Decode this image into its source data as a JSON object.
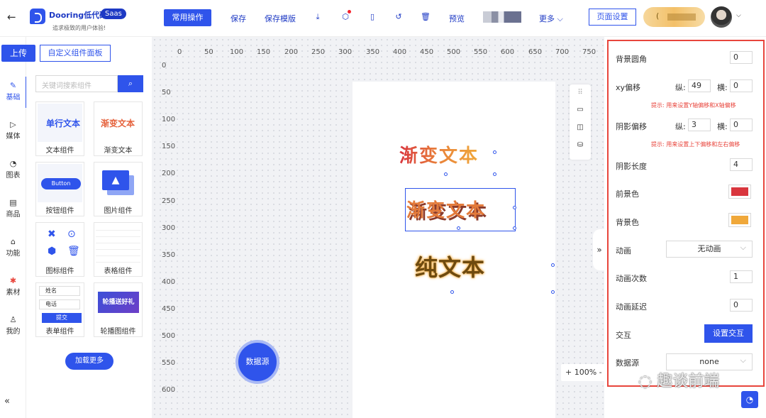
{
  "header": {
    "back_icon": "arrow-left-icon",
    "brand": "Dooring低代码",
    "badge": "Saas",
    "slogan": "追求极致的用户体验!",
    "primary_action": "常用操作",
    "save": "保存",
    "save_template": "保存模版",
    "preview": "预览",
    "more": "更多",
    "page_settings": "页面设置"
  },
  "toolbar": {
    "upload": "上传",
    "custom_panel": "自定义组件面板"
  },
  "nav": [
    {
      "label": "基础",
      "icon": "✎"
    },
    {
      "label": "媒体",
      "icon": "▷"
    },
    {
      "label": "图表",
      "icon": "◔"
    },
    {
      "label": "商品",
      "icon": "▤"
    },
    {
      "label": "功能",
      "icon": "⌂"
    },
    {
      "label": "素材",
      "icon": "✱"
    },
    {
      "label": "我的",
      "icon": "♙"
    }
  ],
  "components": {
    "search_placeholder": "关键词搜索组件",
    "items": [
      {
        "label": "文本组件",
        "thumb_text": "单行文本"
      },
      {
        "label": "渐变文本",
        "thumb_text": "渐变文本"
      },
      {
        "label": "按钮组件",
        "thumb_text": "Button"
      },
      {
        "label": "图片组件",
        "thumb_text": ""
      },
      {
        "label": "图标组件",
        "thumb_text": ""
      },
      {
        "label": "表格组件",
        "thumb_text": ""
      },
      {
        "label": "表单组件",
        "thumb_text": ""
      },
      {
        "label": "轮播图组件",
        "thumb_text": "轮播送好礼"
      }
    ],
    "form_thumb": {
      "name": "姓名",
      "phone": "电话",
      "submit": "提交"
    },
    "load_more": "加载更多"
  },
  "canvas": {
    "ruler_x": [
      "0",
      "50",
      "100",
      "150",
      "200",
      "250",
      "300",
      "350",
      "400",
      "450",
      "500",
      "550",
      "600",
      "650",
      "700",
      "750"
    ],
    "ruler_y": [
      "0",
      "50",
      "100",
      "150",
      "200",
      "250",
      "300",
      "350",
      "400",
      "450",
      "500",
      "550",
      "600"
    ],
    "text1": "渐变文本",
    "text2": "渐变文本",
    "text3": "纯文本",
    "data_source_btn": "数据源",
    "zoom": "+ 100% -"
  },
  "properties": {
    "bg_radius_label": "背景圆角",
    "bg_radius": "0",
    "xy_offset_label": "xy偏移",
    "vertical": "纵:",
    "horizontal": "横:",
    "xy_v": "49",
    "xy_h": "0",
    "xy_hint": "提示: 用来设置Y轴偏移和X轴偏移",
    "shadow_offset_label": "阴影偏移",
    "shadow_v": "3",
    "shadow_h": "0",
    "shadow_hint": "提示: 用来设置上下偏移和左右偏移",
    "shadow_len_label": "阴影长度",
    "shadow_len": "4",
    "fg_color_label": "前景色",
    "fg_color": "#d9363e",
    "bg_color_label": "背景色",
    "bg_color": "#f0a83a",
    "animation_label": "动画",
    "animation_value": "无动画",
    "anim_count_label": "动画次数",
    "anim_count": "1",
    "anim_delay_label": "动画延迟",
    "anim_delay": "0",
    "interaction_label": "交互",
    "interaction_btn": "设置交互",
    "datasource_label": "数据源",
    "datasource_value": "none"
  },
  "watermark": "趣谈前端",
  "colors": {
    "accent": "#2f54eb",
    "frame": "#e8453c"
  }
}
